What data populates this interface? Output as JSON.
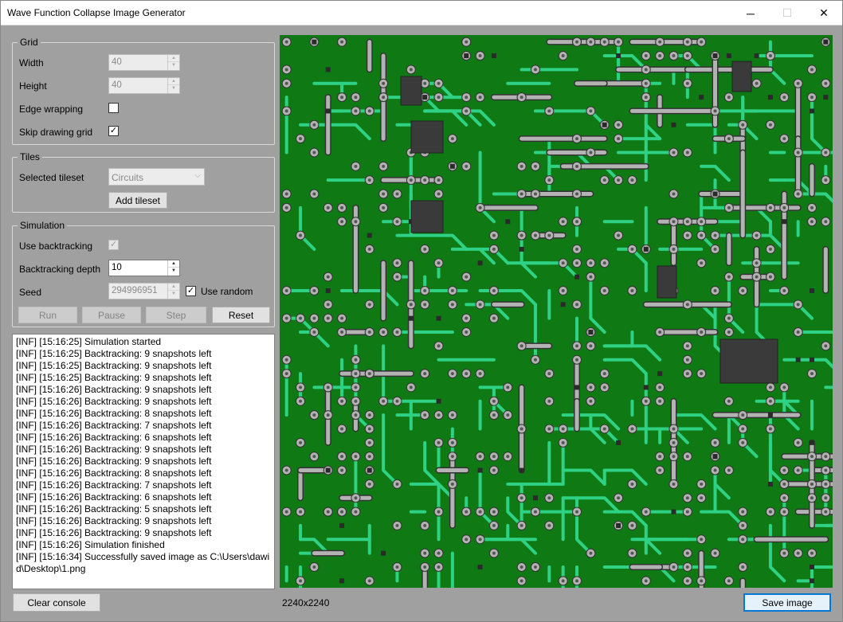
{
  "window": {
    "title": "Wave Function Collapse Image Generator",
    "minimize_glyph": "─",
    "maximize_glyph": "☐",
    "close_glyph": "✕"
  },
  "grid": {
    "legend": "Grid",
    "width_label": "Width",
    "width_value": "40",
    "height_label": "Height",
    "height_value": "40",
    "edge_wrapping_label": "Edge wrapping",
    "edge_wrapping_checked": false,
    "skip_drawing_label": "Skip drawing grid",
    "skip_drawing_checked": true
  },
  "tiles": {
    "legend": "Tiles",
    "selected_tileset_label": "Selected tileset",
    "selected_tileset_value": "Circuits",
    "add_tileset_label": "Add tileset"
  },
  "simulation": {
    "legend": "Simulation",
    "use_backtracking_label": "Use backtracking",
    "use_backtracking_checked": true,
    "backtracking_depth_label": "Backtracking depth",
    "backtracking_depth_value": "10",
    "seed_label": "Seed",
    "seed_value": "294996951",
    "use_random_label": "Use random",
    "use_random_checked": true,
    "run_label": "Run",
    "pause_label": "Pause",
    "step_label": "Step",
    "reset_label": "Reset"
  },
  "console": {
    "lines": [
      "[INF] [15:16:25] Simulation started",
      "[INF] [15:16:25] Backtracking: 9 snapshots left",
      "[INF] [15:16:25] Backtracking: 9 snapshots left",
      "[INF] [15:16:25] Backtracking: 9 snapshots left",
      "[INF] [15:16:26] Backtracking: 9 snapshots left",
      "[INF] [15:16:26] Backtracking: 9 snapshots left",
      "[INF] [15:16:26] Backtracking: 8 snapshots left",
      "[INF] [15:16:26] Backtracking: 7 snapshots left",
      "[INF] [15:16:26] Backtracking: 6 snapshots left",
      "[INF] [15:16:26] Backtracking: 9 snapshots left",
      "[INF] [15:16:26] Backtracking: 9 snapshots left",
      "[INF] [15:16:26] Backtracking: 8 snapshots left",
      "[INF] [15:16:26] Backtracking: 7 snapshots left",
      "[INF] [15:16:26] Backtracking: 6 snapshots left",
      "[INF] [15:16:26] Backtracking: 5 snapshots left",
      "[INF] [15:16:26] Backtracking: 9 snapshots left",
      "[INF] [15:16:26] Backtracking: 9 snapshots left",
      "[INF] [15:16:26] Simulation finished",
      "[INF] [15:16:34] Successfully saved image as C:\\Users\\dawid\\Desktop\\1.png"
    ],
    "clear_label": "Clear console"
  },
  "output": {
    "size_text": "2240x2240",
    "save_label": "Save image"
  },
  "colors": {
    "board": "#0f7a14",
    "trace": "#2fd184",
    "pad": "#b3b3b3",
    "chip": "#3a3a3a"
  },
  "icons": {
    "spinner_up": "▲",
    "spinner_down": "▼",
    "dropdown": "⌵",
    "check": "✓"
  }
}
